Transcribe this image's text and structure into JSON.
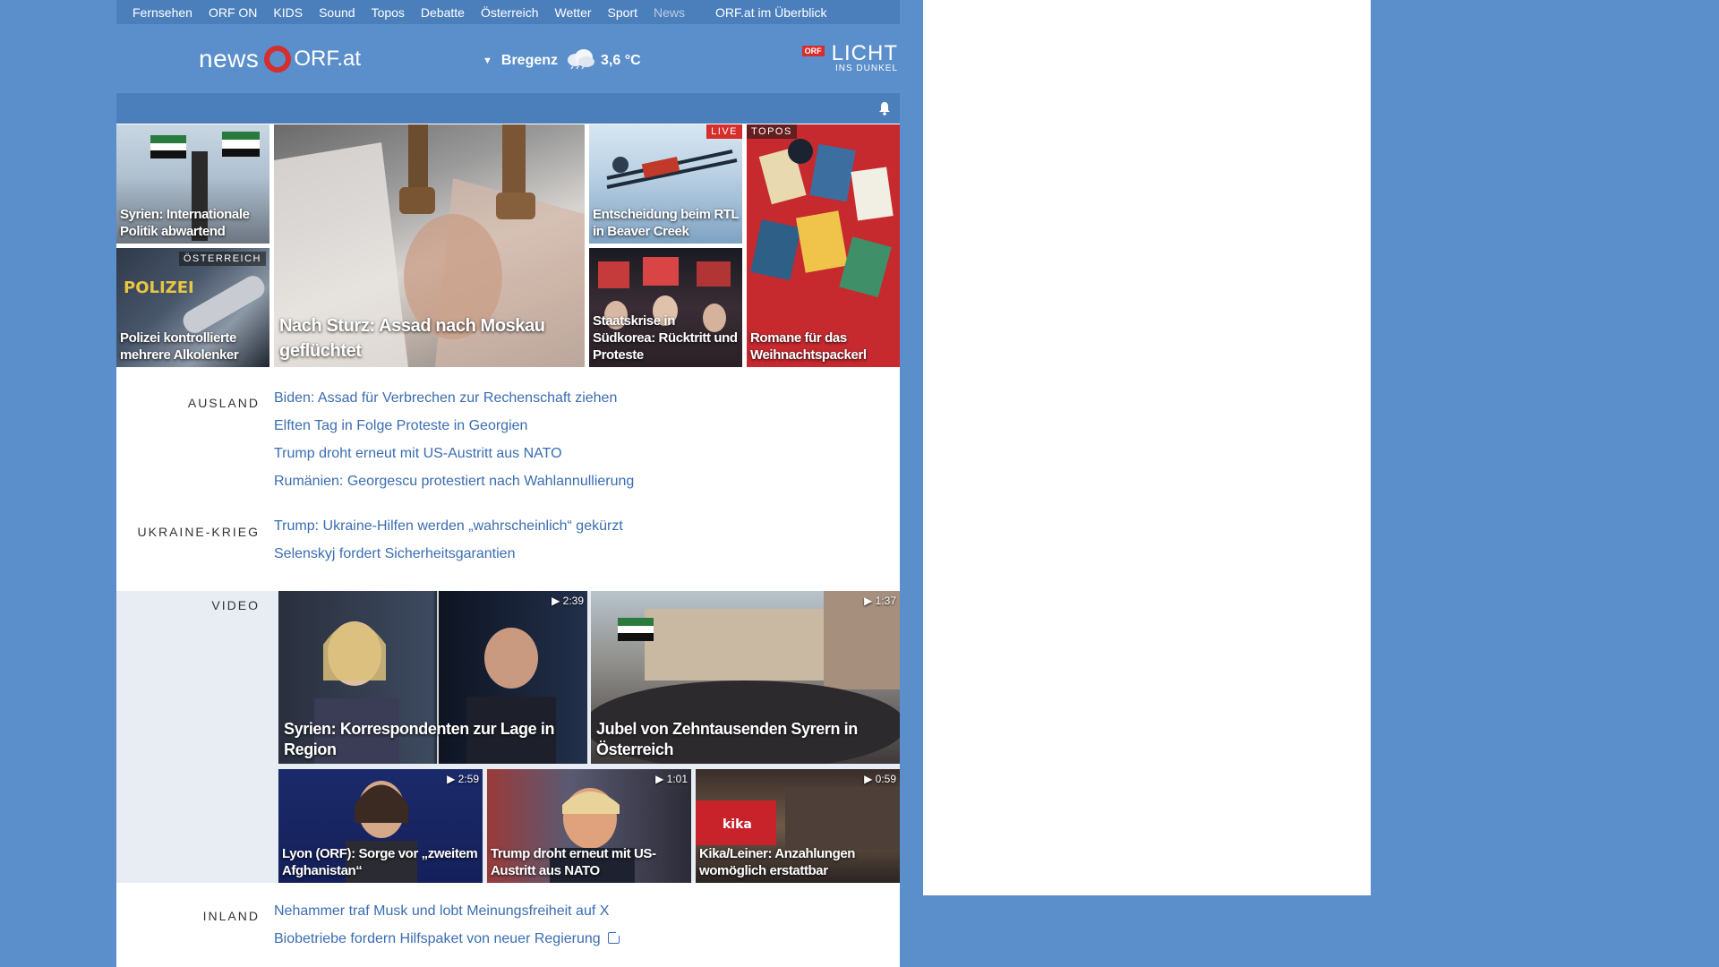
{
  "topnav": {
    "items": [
      "Fernsehen",
      "ORF ON",
      "KIDS",
      "Sound",
      "Topos",
      "Debatte",
      "Österreich",
      "Wetter",
      "Sport",
      "News"
    ],
    "overview": "ORF.at im Überblick"
  },
  "header": {
    "logo_news": "news",
    "logo_orf": "ORF.at",
    "location": "Bregenz",
    "temperature": "3,6 °C",
    "licht_badge": "ORF",
    "licht_big": "LICHT",
    "licht_small": "INS DUNKEL"
  },
  "tiles": {
    "syrien": "Syrien: Internationale Politik abwartend",
    "polizei_tag": "ÖSTERREICH",
    "polizei": "Polizei kontrollierte mehrere Alkolenker",
    "main": "Nach Sturz: Assad nach Moskau geflüchtet",
    "rtl_tag": "LIVE",
    "rtl": "Entscheidung beim RTL in Beaver Creek",
    "korea": "Staatskrise in Südkorea: Rücktritt und Proteste",
    "topos_tag": "TOPOS",
    "romane": "Romane für das Weihnachtspackerl"
  },
  "sections": {
    "ausland": {
      "label": "AUSLAND",
      "links": [
        "Biden: Assad für Verbrechen zur Rechenschaft ziehen",
        "Elften Tag in Folge Proteste in Georgien",
        "Trump droht erneut mit US-Austritt aus NATO",
        "Rumänien: Georgescu protestiert nach Wahlannullierung"
      ]
    },
    "ukraine": {
      "label": "UKRAINE-KRIEG",
      "links": [
        "Trump: Ukraine-Hilfen werden „wahrscheinlich“ gekürzt",
        "Selenskyj fordert Sicherheitsgarantien"
      ]
    },
    "video": {
      "label": "VIDEO",
      "items": [
        {
          "title": "Syrien: Korrespondenten zur Lage in Region",
          "duration": "2:39"
        },
        {
          "title": "Jubel von Zehntausenden Syrern in Österreich",
          "duration": "1:37"
        },
        {
          "title": "Lyon (ORF): Sorge vor „zweitem Afghanistan“",
          "duration": "2:59"
        },
        {
          "title": "Trump droht erneut mit US-Austritt aus NATO",
          "duration": "1:01"
        },
        {
          "title": "Kika/Leiner: Anzahlungen womöglich erstattbar",
          "duration": "0:59"
        }
      ]
    },
    "inland": {
      "label": "INLAND",
      "links": [
        "Nehammer traf Musk und lobt Meinungsfreiheit auf X",
        "Biobetriebe fordern Hilfspaket von neuer Regierung"
      ]
    }
  },
  "colors": {
    "page_bg": "#5a8fcb",
    "nav_bg": "#4b7fbc",
    "link": "#3a6db1",
    "accent_red": "#d62d2d"
  }
}
